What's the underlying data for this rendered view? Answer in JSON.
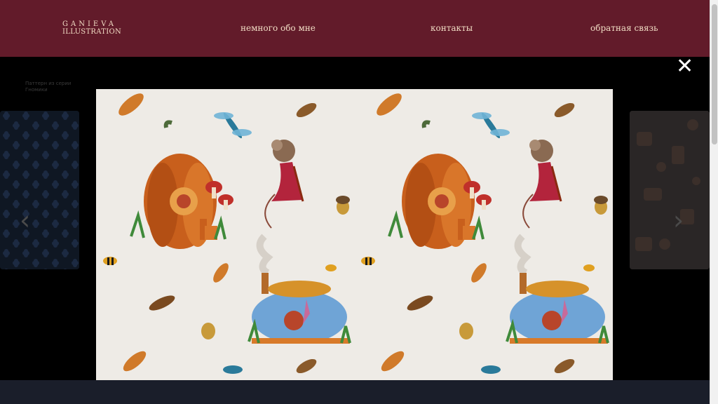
{
  "header": {
    "logo_line1": "GANIEVA",
    "logo_line2": "ILLUSTRATION",
    "nav": {
      "about": "немного обо мне",
      "contacts": "контакты",
      "feedback": "обратная связь"
    }
  },
  "background": {
    "caption_line1": "Паттерн из серии",
    "caption_line2": "Гномики"
  },
  "lightbox": {
    "close_glyph": "✕",
    "prev_glyph": "‹",
    "next_glyph": "›"
  },
  "colors": {
    "header_bg": "#621b2a",
    "accent_text": "#f1dcc4",
    "overlay": "#000000"
  }
}
